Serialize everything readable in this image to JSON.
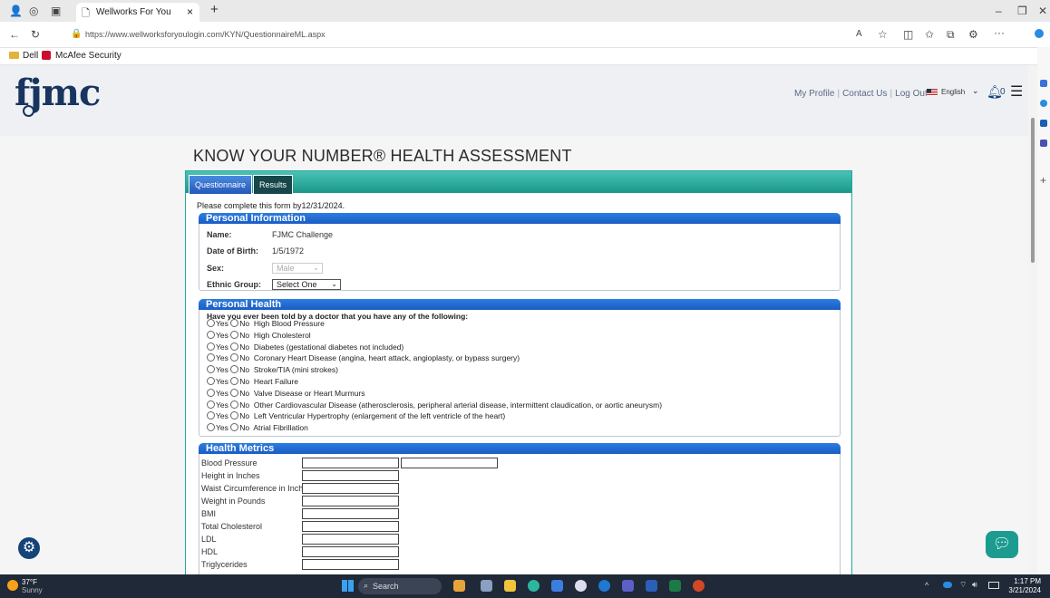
{
  "browser": {
    "tab_title": "Wellworks For You",
    "new_tab": "+",
    "tab_close": "×",
    "url": "https://www.wellworksforyoulogin.com/KYN/QuestionnaireML.aspx",
    "favorites": [
      "Dell",
      "McAfee Security"
    ]
  },
  "site": {
    "logo": "fjmc",
    "links": [
      "My Profile",
      "Contact Us",
      "Log Out"
    ],
    "language": "English",
    "notification_count": "0"
  },
  "page": {
    "title": "KNOW YOUR NUMBER® HEALTH ASSESSMENT",
    "tabs": [
      "Questionnaire",
      "Results"
    ],
    "due_text": "Please complete this form by12/31/2024."
  },
  "personal_info": {
    "heading": "Personal Information",
    "name_label": "Name:",
    "name_value": "FJMC Challenge",
    "dob_label": "Date of Birth:",
    "dob_value": "1/5/1972",
    "sex_label": "Sex:",
    "sex_value": "Male",
    "ethnic_label": "Ethnic Group:",
    "ethnic_value": "Select One"
  },
  "personal_health": {
    "heading": "Personal Health",
    "question": "Have you ever been told by a doctor that you have any of the following:",
    "yes": "Yes",
    "no": "No",
    "conditions": [
      "High Blood Pressure",
      "High Cholesterol",
      "Diabetes (gestational diabetes not included)",
      "Coronary Heart Disease (angina, heart attack, angioplasty, or bypass surgery)",
      "Stroke/TIA (mini strokes)",
      "Heart Failure",
      "Valve Disease or Heart Murmurs",
      "Other Cardiovascular Disease (atherosclerosis, peripheral arterial disease, intermittent claudication, or aortic aneurysm)",
      "Left Ventricular Hypertrophy (enlargement of the left ventricle of the heart)",
      "Atrial Fibrillation"
    ]
  },
  "health_metrics": {
    "heading": "Health Metrics",
    "fields": [
      "Blood Pressure",
      "Height in Inches",
      "Waist Circumference in Inches",
      "Weight in Pounds",
      "BMI",
      "Total Cholesterol",
      "LDL",
      "HDL",
      "Triglycerides"
    ]
  },
  "taskbar": {
    "temp": "37°F",
    "condition": "Sunny",
    "search": "Search",
    "time": "1:17 PM",
    "date": "3/21/2024"
  }
}
